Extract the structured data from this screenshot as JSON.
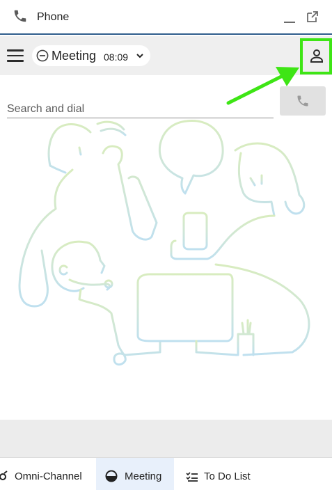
{
  "window": {
    "title": "Phone"
  },
  "toolbar": {
    "status": {
      "label": "Meeting",
      "timer": "08:09"
    }
  },
  "dialer": {
    "placeholder": "Search and dial"
  },
  "bottom_nav": {
    "items": [
      {
        "label": "Omni-Channel"
      },
      {
        "label": "Meeting"
      },
      {
        "label": "To Do List"
      }
    ]
  },
  "colors": {
    "accent_border": "#2f5d8c",
    "annotation_green": "#3ee515",
    "active_tab": "#e8f0fb"
  },
  "icons": [
    "phone-icon",
    "minimize-icon",
    "popout-icon",
    "menu-icon",
    "busy-status-icon",
    "chevron-down-icon",
    "user-icon",
    "call-icon",
    "omni-channel-icon",
    "meeting-status-icon",
    "todo-list-icon"
  ]
}
